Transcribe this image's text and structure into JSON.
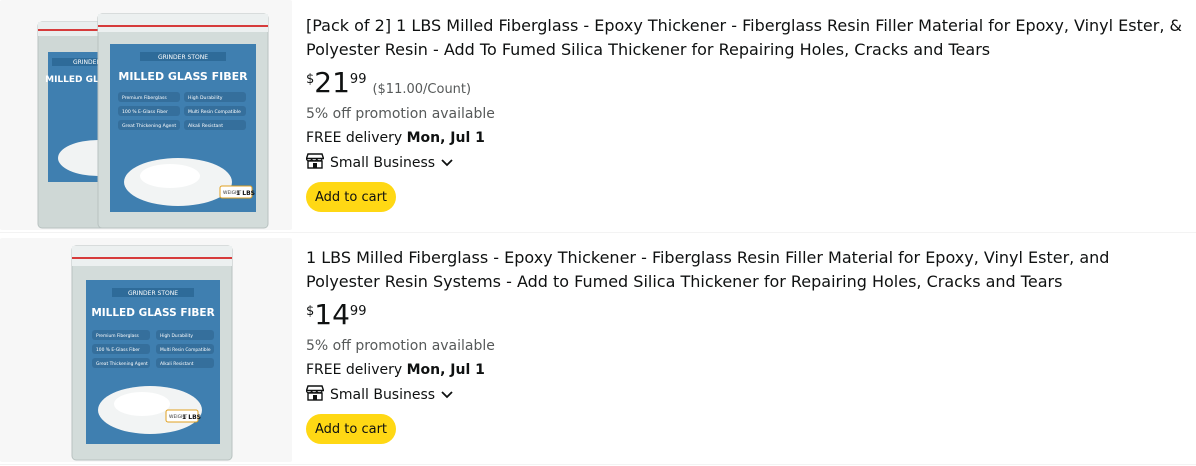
{
  "results": [
    {
      "title": "[Pack of 2] 1 LBS Milled Fiberglass - Epoxy Thickener - Fiberglass Resin Filler Material for Epoxy, Vinyl Ester, & Polyester Resin - Add To Fumed Silica Thickener for Repairing Holes, Cracks and Tears",
      "price_symbol": "$",
      "price_whole": "21",
      "price_fraction": "99",
      "unit_price": "($11.00/Count)",
      "promotion": "5% off promotion available",
      "delivery_prefix": "FREE delivery ",
      "delivery_date": "Mon, Jul 1",
      "badge": "Small Business",
      "button": "Add to cart",
      "image": {
        "brand": "GRINDER STONE",
        "product": "MILLED GLASS FIBER",
        "features": [
          "Premium Fiberglass",
          "High Durability",
          "100 % E-Glass Fiber",
          "Multi Resin Compatible",
          "Great Thickening Agent",
          "Alkali Resistant"
        ],
        "weight_label": "WEIGHT",
        "weight": "1 LBS"
      }
    },
    {
      "title": "1 LBS Milled Fiberglass - Epoxy Thickener - Fiberglass Resin Filler Material for Epoxy, Vinyl Ester, and Polyester Resin Systems - Add to Fumed Silica Thickener for Repairing Holes, Cracks and Tears",
      "price_symbol": "$",
      "price_whole": "14",
      "price_fraction": "99",
      "promotion": "5% off promotion available",
      "delivery_prefix": "FREE delivery ",
      "delivery_date": "Mon, Jul 1",
      "badge": "Small Business",
      "button": "Add to cart",
      "image": {
        "brand": "GRINDER STONE",
        "product": "MILLED GLASS FIBER",
        "features": [
          "Premium Fiberglass",
          "High Durability",
          "100 % E-Glass Fiber",
          "Multi Resin Compatible",
          "Great Thickening Agent",
          "Alkali Resistant"
        ],
        "weight_label": "WEIGHT",
        "weight": "1 LBS"
      }
    }
  ],
  "colors": {
    "button_yellow": "#ffd814",
    "text": "#0f1111",
    "muted": "#565959",
    "label_blue": "#3f7fb0"
  }
}
